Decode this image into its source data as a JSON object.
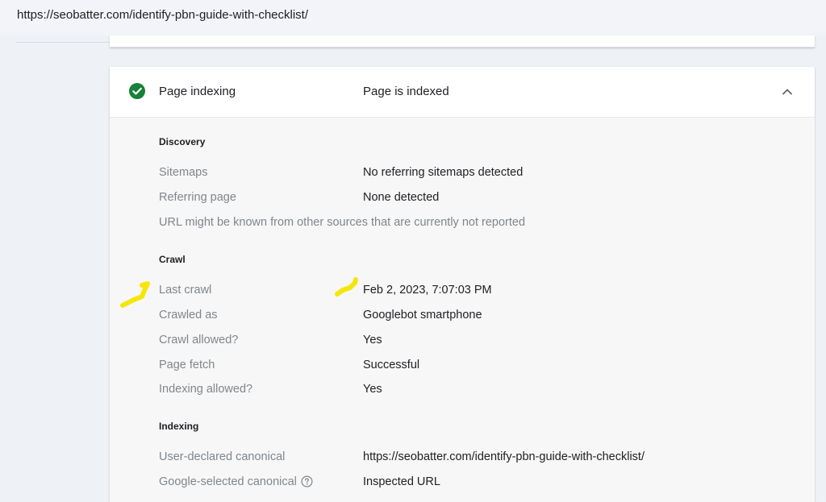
{
  "address_bar": {
    "url": "https://seobatter.com/identify-pbn-guide-with-checklist/"
  },
  "panel": {
    "title": "Page indexing",
    "status": "Page is indexed",
    "status_color": "#188038",
    "icons": {
      "status": "check-circle-icon",
      "collapse": "chevron-up-icon",
      "help": "help-icon"
    },
    "discovery": {
      "heading": "Discovery",
      "rows": [
        {
          "label": "Sitemaps",
          "value": "No referring sitemaps detected"
        },
        {
          "label": "Referring page",
          "value": "None detected"
        }
      ],
      "note": "URL might be known from other sources that are currently not reported"
    },
    "crawl": {
      "heading": "Crawl",
      "rows": [
        {
          "label": "Last crawl",
          "value": "Feb 2, 2023, 7:07:03 PM"
        },
        {
          "label": "Crawled as",
          "value": "Googlebot smartphone"
        },
        {
          "label": "Crawl allowed?",
          "value": "Yes"
        },
        {
          "label": "Page fetch",
          "value": "Successful"
        },
        {
          "label": "Indexing allowed?",
          "value": "Yes"
        }
      ]
    },
    "indexing": {
      "heading": "Indexing",
      "rows": [
        {
          "label": "User-declared canonical",
          "value": "https://seobatter.com/identify-pbn-guide-with-checklist/"
        },
        {
          "label": "Google-selected canonical",
          "value": "Inspected URL"
        }
      ]
    }
  },
  "annotation_color": "#f5e60a"
}
